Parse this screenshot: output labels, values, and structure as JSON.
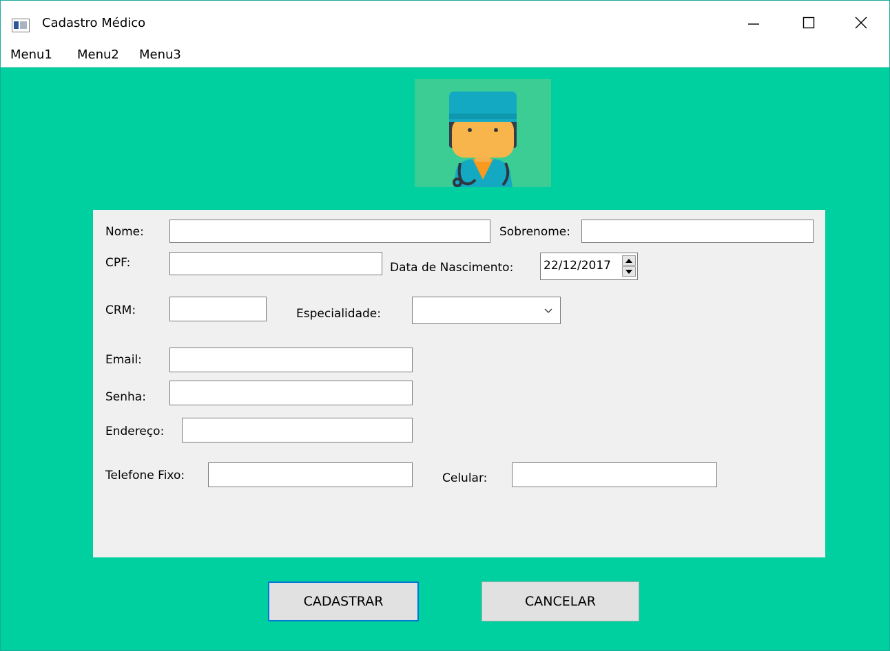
{
  "window": {
    "title": "Cadastro Médico",
    "minimize_icon": "minimize-icon",
    "maximize_icon": "maximize-icon",
    "close_icon": "close-icon"
  },
  "menubar": {
    "items": [
      "Menu1",
      "Menu2",
      "Menu3"
    ]
  },
  "header_image": {
    "icon": "doctor-avatar-icon"
  },
  "form": {
    "nome": {
      "label": "Nome:",
      "value": ""
    },
    "sobrenome": {
      "label": "Sobrenome:",
      "value": ""
    },
    "cpf": {
      "label": "CPF:",
      "value": ""
    },
    "data_nascimento": {
      "label": "Data de Nascimento:",
      "value": "22/12/2017"
    },
    "crm": {
      "label": "CRM:",
      "value": ""
    },
    "especialidade": {
      "label": "Especialidade:",
      "value": ""
    },
    "email": {
      "label": "Email:",
      "value": ""
    },
    "senha": {
      "label": "Senha:",
      "value": ""
    },
    "endereco": {
      "label": "Endereço:",
      "value": ""
    },
    "telefone_fixo": {
      "label": "Telefone Fixo:",
      "value": ""
    },
    "celular": {
      "label": "Celular:",
      "value": ""
    }
  },
  "buttons": {
    "cadastrar": "CADASTRAR",
    "cancelar": "CANCELAR"
  },
  "colors": {
    "background": "#00cf9f",
    "panel": "#f0f0f0",
    "focus_border": "#0078d7"
  }
}
